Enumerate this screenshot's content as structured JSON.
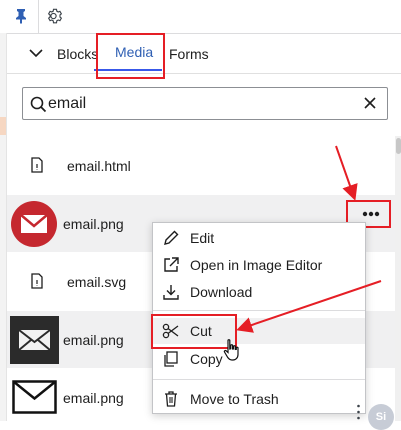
{
  "toolbar": {
    "pin_icon": "pin-icon",
    "settings_icon": "gear-icon"
  },
  "tabs": [
    {
      "label": "Blocks",
      "active": false
    },
    {
      "label": "Media",
      "active": true
    },
    {
      "label": "Forms",
      "active": false
    }
  ],
  "search": {
    "value": "email",
    "placeholder": "Search",
    "search_icon": "search-icon",
    "clear_icon": "close-icon"
  },
  "media_items": [
    {
      "name": "email.html",
      "kind": "file"
    },
    {
      "name": "email.png",
      "kind": "image-red-circle-envelope"
    },
    {
      "name": "email.svg",
      "kind": "file"
    },
    {
      "name": "email.png",
      "kind": "image-dark-envelope"
    },
    {
      "name": "email.png",
      "kind": "image-outline-envelope"
    }
  ],
  "context_menu": {
    "items": [
      {
        "label": "Edit",
        "icon": "pencil-icon"
      },
      {
        "label": "Open in Image Editor",
        "icon": "external-link-icon"
      },
      {
        "label": "Download",
        "icon": "download-icon"
      },
      {
        "label": "Cut",
        "icon": "scissors-icon",
        "highlighted": true
      },
      {
        "label": "Copy",
        "icon": "copy-icon"
      },
      {
        "label": "Move to Trash",
        "icon": "trash-icon"
      }
    ]
  },
  "avatar": {
    "initials": "Si"
  },
  "colors": {
    "accent": "#3858e9",
    "annotation": "#e51e25",
    "hover_row": "#f0f0f1"
  }
}
